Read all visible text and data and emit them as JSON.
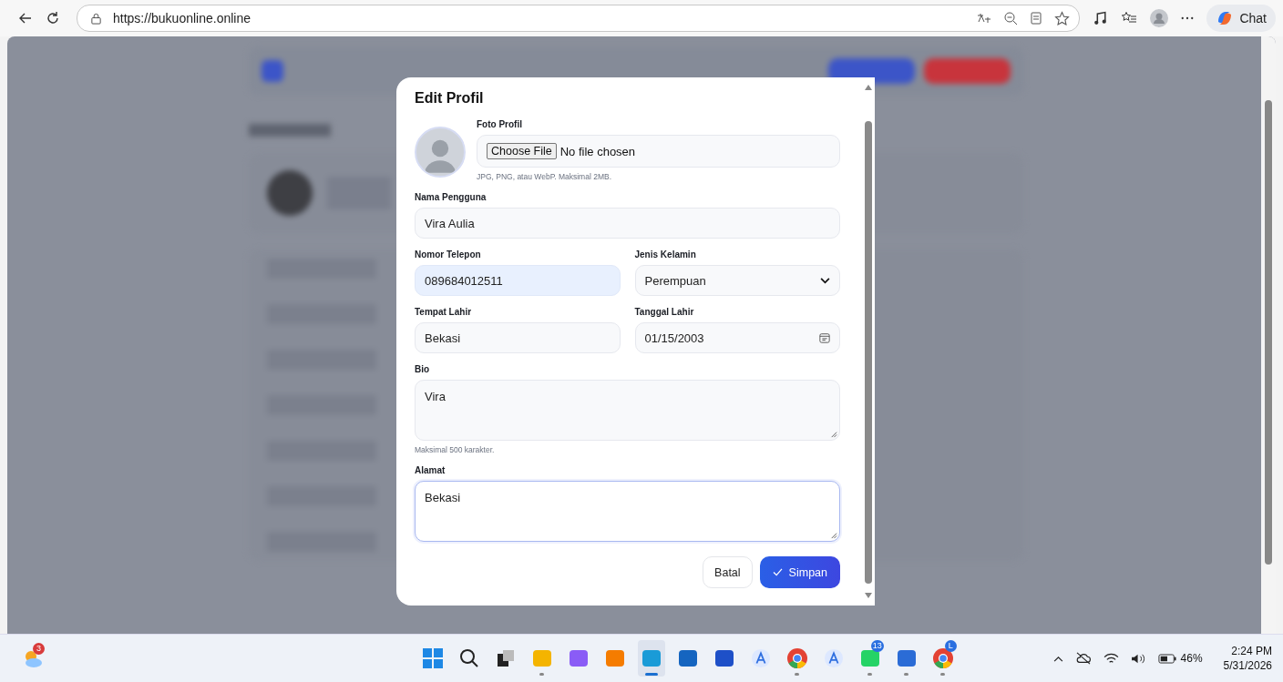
{
  "browser": {
    "url": "https://bukuonline.online",
    "chat_label": "Chat"
  },
  "modal": {
    "title": "Edit Profil",
    "photo_label": "Foto Profil",
    "file_button": "Choose File",
    "file_status": "No file chosen",
    "file_hint": "JPG, PNG, atau WebP. Maksimal 2MB.",
    "rows": [
      {
        "fields": [
          {
            "kind": "text",
            "label": "Nama Pengguna",
            "value": "Vira Aulia",
            "focused": false,
            "autofilled": false
          }
        ]
      },
      {
        "fields": [
          {
            "kind": "text",
            "label": "Nomor Telepon",
            "value": "089684012511",
            "focused": false,
            "autofilled": true
          },
          {
            "kind": "select",
            "label": "Jenis Kelamin",
            "value": "Perempuan",
            "focused": false,
            "autofilled": false
          }
        ]
      },
      {
        "fields": [
          {
            "kind": "text",
            "label": "Tempat Lahir",
            "value": "Bekasi",
            "focused": false,
            "autofilled": false
          },
          {
            "kind": "date",
            "label": "Tanggal Lahir",
            "value": "01/15/2003",
            "focused": false,
            "autofilled": false
          }
        ]
      },
      {
        "fields": [
          {
            "kind": "textarea",
            "label": "Bio",
            "value": "Vira",
            "hint": "Maksimal 500 karakter.",
            "focused": false,
            "autofilled": false
          }
        ]
      },
      {
        "fields": [
          {
            "kind": "textarea",
            "label": "Alamat",
            "value": "Bekasi",
            "focused": true,
            "autofilled": false
          }
        ]
      }
    ],
    "buttons": [
      {
        "kind": "secondary",
        "label": "Batal"
      },
      {
        "kind": "primary",
        "label": "Simpan"
      }
    ]
  },
  "taskbar": {
    "weather_badge": "3",
    "apps": [
      {
        "kind": "start",
        "running": false,
        "selected": false
      },
      {
        "kind": "search",
        "running": false,
        "selected": false
      },
      {
        "kind": "taskview",
        "running": false,
        "selected": false
      },
      {
        "kind": "folder",
        "running": true,
        "selected": false
      },
      {
        "kind": "copilot",
        "running": false,
        "selected": false
      },
      {
        "kind": "xampp",
        "running": false,
        "selected": false
      },
      {
        "kind": "edge",
        "running": true,
        "selected": true
      },
      {
        "kind": "store",
        "running": false,
        "selected": false
      },
      {
        "kind": "tile",
        "running": false,
        "selected": false
      },
      {
        "kind": "letter",
        "running": false,
        "selected": false
      },
      {
        "kind": "chrome",
        "running": true,
        "selected": false
      },
      {
        "kind": "letter",
        "running": false,
        "selected": false
      },
      {
        "kind": "whatsapp",
        "running": true,
        "selected": false,
        "badge": "13"
      },
      {
        "kind": "word",
        "running": true,
        "selected": false
      },
      {
        "kind": "chrome",
        "running": true,
        "selected": false,
        "badge": "L"
      }
    ],
    "battery": "46%",
    "time": "2:24 PM",
    "date": "5/31/2026"
  }
}
